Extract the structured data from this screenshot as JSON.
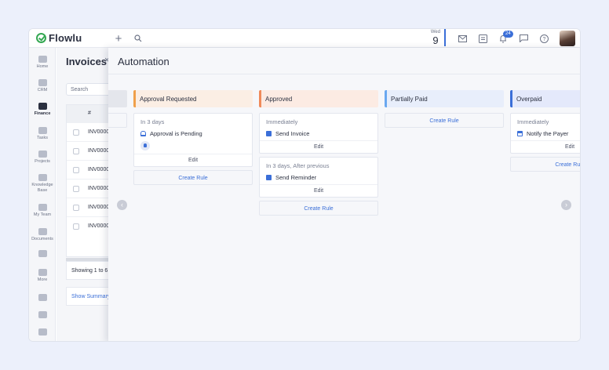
{
  "app": {
    "name": "Flowlu"
  },
  "topbar": {
    "date_dow": "Wed",
    "date_day": "9",
    "notifications_count": "24"
  },
  "leftnav": {
    "items": [
      {
        "label": "Home",
        "icon": "home-icon"
      },
      {
        "label": "CRM",
        "icon": "crm-icon"
      },
      {
        "label": "Finance",
        "icon": "finance-icon",
        "active": true
      },
      {
        "label": "Tasks",
        "icon": "tasks-icon"
      },
      {
        "label": "Projects",
        "icon": "projects-icon"
      },
      {
        "label": "Knowledge Base",
        "icon": "knowledge-base-icon"
      },
      {
        "label": "My Team",
        "icon": "team-icon"
      },
      {
        "label": "Documents",
        "icon": "documents-icon"
      },
      {
        "label": "More",
        "icon": "more-icon"
      }
    ]
  },
  "invoices": {
    "title": "Invoices",
    "search_placeholder": "Search",
    "column_number": "#",
    "rows": [
      "INV0000",
      "INV0000",
      "INV0000",
      "INV0000",
      "INV0000",
      "INV0000"
    ],
    "showing": "Showing 1 to 6",
    "show_summary": "Show Summary"
  },
  "automation": {
    "title": "Automation",
    "columns": [
      {
        "name": "Approval Requested",
        "color": "#f0a04b",
        "bg": "#fbeee4",
        "cards": [
          {
            "when": "In 3 days",
            "action": "Approval is Pending",
            "icon": "bell-icon",
            "has_user": true,
            "edit": "Edit"
          }
        ],
        "create_rule": "Create Rule"
      },
      {
        "name": "Approved",
        "color": "#f08a5a",
        "bg": "#fcebe3",
        "cards": [
          {
            "when": "Immediately",
            "action": "Send Invoice",
            "icon": "document-icon",
            "has_user": false,
            "edit": "Edit"
          },
          {
            "when": "In 3 days, After previous",
            "action": "Send Reminder",
            "icon": "document-icon",
            "has_user": false,
            "edit": "Edit"
          }
        ],
        "create_rule": "Create Rule"
      },
      {
        "name": "Partially Paid",
        "color": "#6aa8f0",
        "bg": "#e8eefb",
        "cards": [],
        "create_rule": "Create Rule"
      },
      {
        "name": "Overpaid",
        "color": "#3b6fd8",
        "bg": "#e4e9fb",
        "cards": [
          {
            "when": "Immediately",
            "action": "Notify the Payer",
            "icon": "calendar-icon",
            "has_user": false,
            "edit": "Edit"
          }
        ],
        "create_rule": "Create Rule"
      }
    ]
  }
}
